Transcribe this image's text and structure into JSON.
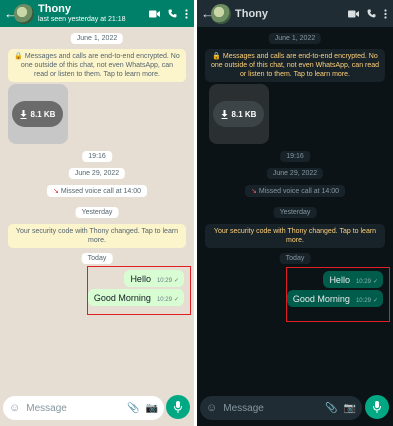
{
  "contact": {
    "name": "Thony",
    "status": "last seen yesterday at 21:18"
  },
  "chips": {
    "date1": "June 1, 2022",
    "time1": "19:16",
    "date2": "June 29, 2022",
    "yesterday": "Yesterday",
    "today": "Today"
  },
  "encryption_notice": "Messages and calls are end-to-end encrypted. No one outside of this chat, not even WhatsApp, can read or listen to them. Tap to learn more.",
  "media": {
    "size": "8.1 KB"
  },
  "missed_call": "Missed voice call at 14:00",
  "security_notice": "Your security code with Thony changed. Tap to learn more.",
  "messages": [
    {
      "text": "Hello",
      "time": "10:29"
    },
    {
      "text": "Good Morning",
      "time": "10:29"
    }
  ],
  "input": {
    "placeholder": "Message"
  },
  "icons": [
    "back-arrow-icon",
    "avatar",
    "video-call-icon",
    "voice-call-icon",
    "menu-icon",
    "lock-icon",
    "download-icon",
    "missed-call-icon",
    "read-check-icon",
    "emoji-icon",
    "attach-icon",
    "camera-icon",
    "mic-icon"
  ],
  "colors": {
    "light_header": "#008069",
    "dark_header": "#1f2c33",
    "light_bg": "#e7ded3",
    "dark_bg": "#0c1317",
    "light_out_bubble": "#d9fdd3",
    "dark_out_bubble": "#005c4b",
    "accent": "#00a884",
    "highlight_box": "#e01f24"
  },
  "themes": [
    "light",
    "dark"
  ]
}
